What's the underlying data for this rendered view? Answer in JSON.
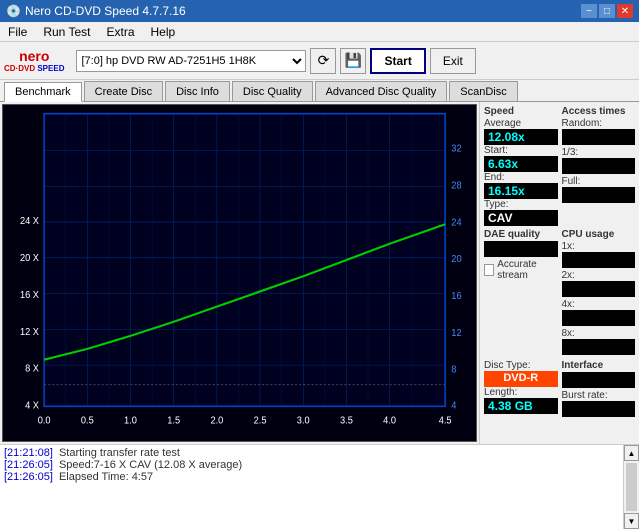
{
  "titlebar": {
    "title": "Nero CD-DVD Speed 4.7.7.16",
    "icon": "cd-icon",
    "controls": [
      "minimize",
      "maximize",
      "close"
    ]
  },
  "menubar": {
    "items": [
      "File",
      "Run Test",
      "Extra",
      "Help"
    ]
  },
  "toolbar": {
    "drive_label": "[7:0]  hp DVD RW AD-7251H5 1H8K",
    "start_label": "Start",
    "exit_label": "Exit"
  },
  "tabs": {
    "items": [
      "Benchmark",
      "Create Disc",
      "Disc Info",
      "Disc Quality",
      "Advanced Disc Quality",
      "ScanDisc"
    ],
    "active": "Benchmark"
  },
  "speed_panel": {
    "speed_title": "Speed",
    "average_label": "Average",
    "average_value": "12.08x",
    "start_label": "Start:",
    "start_value": "6.63x",
    "end_label": "End:",
    "end_value": "16.15x",
    "type_label": "Type:",
    "type_value": "CAV"
  },
  "access_panel": {
    "title": "Access times",
    "random_label": "Random:",
    "random_value": "",
    "one_third_label": "1/3:",
    "one_third_value": "",
    "full_label": "Full:",
    "full_value": ""
  },
  "cpu_panel": {
    "title": "CPU usage",
    "1x_label": "1x:",
    "1x_value": "",
    "2x_label": "2x:",
    "2x_value": "",
    "4x_label": "4x:",
    "4x_value": "",
    "8x_label": "8x:",
    "8x_value": ""
  },
  "dae_panel": {
    "title": "DAE quality",
    "value": "",
    "accurate_stream_label": "Accurate stream"
  },
  "disc_panel": {
    "type_label": "Disc Type:",
    "type_value": "DVD-R",
    "length_label": "Length:",
    "length_value": "4.38 GB",
    "burst_label": "Burst rate:",
    "burst_value": ""
  },
  "interface_panel": {
    "title": "Interface",
    "burst_label": "Burst rate:",
    "burst_value": ""
  },
  "chart": {
    "x_labels": [
      "0.0",
      "0.5",
      "1.0",
      "1.5",
      "2.0",
      "2.5",
      "3.0",
      "3.5",
      "4.0",
      "4.5"
    ],
    "y_left_labels": [
      "4 X",
      "8 X",
      "12 X",
      "16 X",
      "20 X",
      "24 X"
    ],
    "y_right_labels": [
      "4",
      "8",
      "12",
      "16",
      "20",
      "24",
      "28",
      "32"
    ]
  },
  "log": {
    "lines": [
      {
        "timestamp": "[21:21:08]",
        "text": "Starting transfer rate test"
      },
      {
        "timestamp": "[21:26:05]",
        "text": "Speed:7-16 X CAV (12.08 X average)"
      },
      {
        "timestamp": "[21:26:05]",
        "text": "Elapsed Time: 4:57"
      }
    ]
  }
}
